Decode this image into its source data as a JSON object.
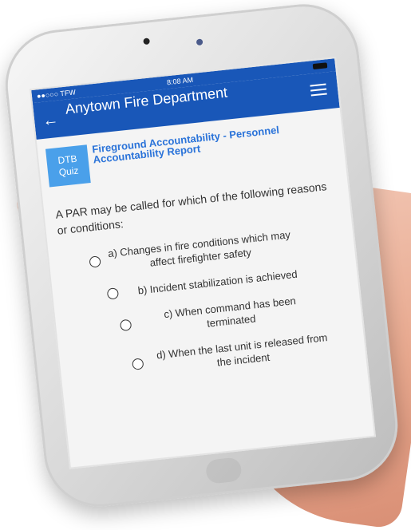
{
  "statusbar": {
    "carrier": "●●○○○ TFW",
    "time": "8:08 AM"
  },
  "appbar": {
    "title": "Anytown Fire Department",
    "back_icon": "arrow-left-icon",
    "menu_icon": "hamburger-menu-icon"
  },
  "quiz": {
    "badge_line1": "DTB",
    "badge_line2": "Quiz",
    "topic": "Fireground Accountability - Personnel Accountability Report"
  },
  "question": "A PAR may be called for which of the following reasons or conditions:",
  "options": [
    {
      "label": "a) Changes in fire conditions which may affect firefighter safety"
    },
    {
      "label": "b) Incident stabilization is achieved"
    },
    {
      "label": "c) When command has been terminated"
    },
    {
      "label": "d) When the last unit is released from the incident"
    }
  ],
  "colors": {
    "appbar": "#1957b8",
    "badge": "#4aa0ea",
    "topic": "#2a73d9"
  }
}
